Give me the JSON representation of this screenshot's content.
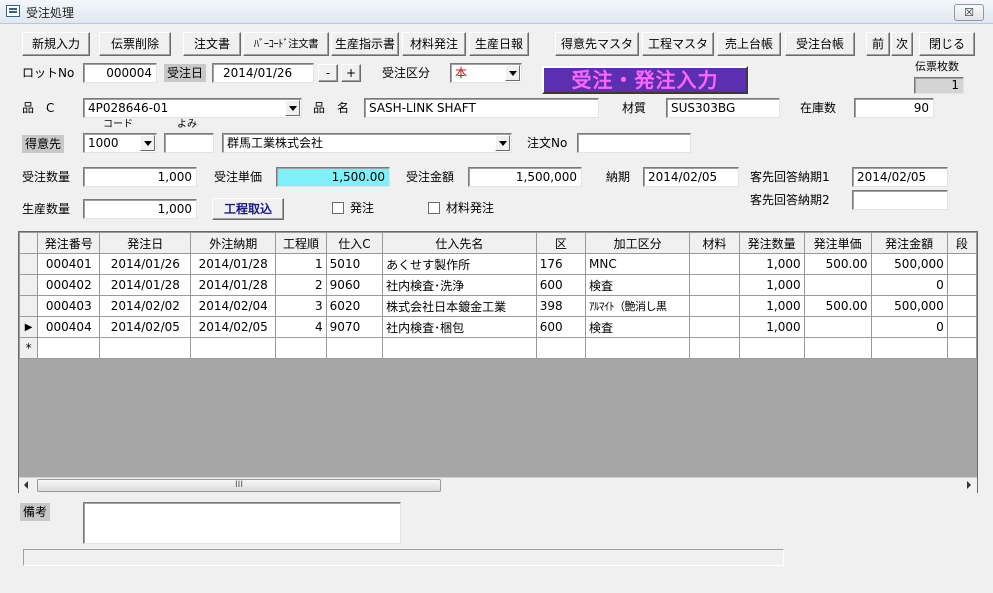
{
  "window": {
    "title": "受注処理",
    "close_glyph": "☒"
  },
  "toolbar": {
    "new_entry": "新規入力",
    "delete_slip": "伝票削除",
    "order_sheet": "注文書",
    "barcode_order": "ﾊﾞｰｺｰﾄﾞ注文書",
    "production_instruction": "生産指示書",
    "material_order": "材料発注",
    "production_daily": "生産日報",
    "customer_master": "得意先マスタ",
    "process_master": "工程マスタ",
    "sales_ledger": "売上台帳",
    "order_ledger": "受注台帳",
    "prev": "前",
    "next": "次",
    "close": "閉じる"
  },
  "header": {
    "lot_label": "ロットNo",
    "lot_value": "000004",
    "order_date_label": "受注日",
    "order_date_value": "2014/01/26",
    "minus": "-",
    "plus": "+",
    "order_type_label": "受注区分",
    "order_type_value": "本",
    "big_title": "受注・発注入力",
    "slip_count_label": "伝票枚数",
    "slip_count_value": "1"
  },
  "product": {
    "code_label": "品　C",
    "code_value": "4P028646-01",
    "name_label": "品　名",
    "name_value": "SASH-LINK  SHAFT",
    "material_label": "材質",
    "material_value": "SUS303BG",
    "stock_label": "在庫数",
    "stock_value": "90"
  },
  "customer": {
    "label": "得意先",
    "code_caption": "コード",
    "reading_caption": "よみ",
    "code_value": "1000",
    "reading_value": "",
    "name_value": "群馬工業株式会社",
    "po_label": "注文No",
    "po_value": ""
  },
  "amounts": {
    "qty_label": "受注数量",
    "qty_value": "1,000",
    "unit_price_label": "受注単価",
    "unit_price_value": "1,500.00",
    "amount_label": "受注金額",
    "amount_value": "1,500,000",
    "due_label": "納期",
    "due_value": "2014/02/05",
    "reply1_label": "客先回答納期1",
    "reply1_value": "2014/02/05",
    "reply2_label": "客先回答納期2",
    "reply2_value": "",
    "prod_qty_label": "生産数量",
    "prod_qty_value": "1,000",
    "import_process": "工程取込",
    "order_check_label": "発注",
    "material_check_label": "材料発注"
  },
  "grid": {
    "headers": [
      "発注番号",
      "発注日",
      "外注納期",
      "工程順",
      "仕入C",
      "仕入先名",
      "区",
      "加工区分",
      "材料",
      "発注数量",
      "発注単価",
      "発注金額",
      "段"
    ],
    "rows": [
      [
        "000401",
        "2014/01/26",
        "2014/01/28",
        "1",
        "5010",
        "あくせす製作所",
        "176",
        "MNC",
        "",
        "1,000",
        "500.00",
        "500,000",
        ""
      ],
      [
        "000402",
        "2014/01/28",
        "2014/01/28",
        "2",
        "9060",
        "社内検査･洗浄",
        "600",
        "検査",
        "",
        "1,000",
        "",
        "0",
        ""
      ],
      [
        "000403",
        "2014/02/02",
        "2014/02/04",
        "3",
        "6020",
        "株式会社日本鍍金工業",
        "398",
        "ｱﾙﾏｲﾄ（艶消し黒",
        "",
        "1,000",
        "500.00",
        "500,000",
        ""
      ],
      [
        "000404",
        "2014/02/05",
        "2014/02/05",
        "4",
        "9070",
        "社内検査･梱包",
        "600",
        "検査",
        "",
        "1,000",
        "",
        "0",
        ""
      ]
    ],
    "row_markers": [
      "",
      "",
      "",
      "▶",
      "*"
    ],
    "scroll_thumb_glyph": "III"
  },
  "remarks": {
    "label": "備考",
    "value": ""
  }
}
